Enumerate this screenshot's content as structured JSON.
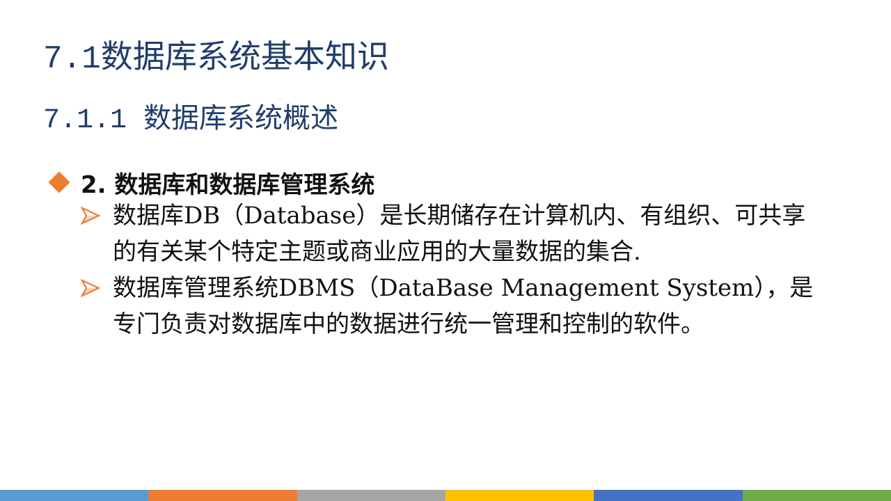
{
  "slide": {
    "title": "7.1数据库系统基本知识",
    "subtitle": "7.1.1 数据库系统概述",
    "point": {
      "icon": "diamond-bullet-icon",
      "label": "2. 数据库和数据库管理系统"
    },
    "bullets": [
      {
        "icon": "arrow-bullet-icon",
        "text": "数据库DB（Database）是长期储存在计算机内、有组织、可共享的有关某个特定主题或商业应用的大量数据的集合."
      },
      {
        "icon": "arrow-bullet-icon",
        "text": "数据库管理系统DBMS（DataBase Management System），是专门负责对数据库中的数据进行统一管理和控制的软件。"
      }
    ]
  },
  "colors": {
    "title": "#1f3d6b",
    "accent": "#ed7d31",
    "bar": [
      "#5b9bd5",
      "#ed7d31",
      "#a5a5a5",
      "#ffc000",
      "#4472c4",
      "#70ad47"
    ]
  }
}
